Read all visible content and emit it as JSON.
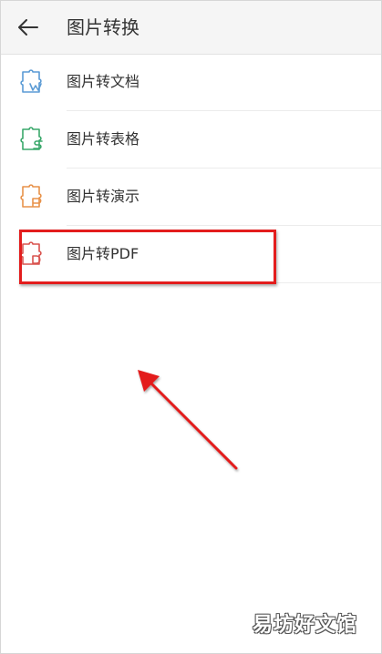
{
  "header": {
    "title": "图片转换",
    "back_icon": "arrow-left-icon"
  },
  "menu": {
    "items": [
      {
        "label": "图片转文档",
        "icon": "picture-to-doc-icon",
        "color": "#5b9bd5"
      },
      {
        "label": "图片转表格",
        "icon": "picture-to-sheet-icon",
        "color": "#3aa86b"
      },
      {
        "label": "图片转演示",
        "icon": "picture-to-slides-icon",
        "color": "#e8924a"
      },
      {
        "label": "图片转PDF",
        "icon": "picture-to-pdf-icon",
        "color": "#d9534f"
      }
    ]
  },
  "annotations": {
    "highlight_color": "#e31d1d",
    "arrow_color": "#e31d1d"
  },
  "watermark": {
    "text": "易坊好文馆"
  }
}
